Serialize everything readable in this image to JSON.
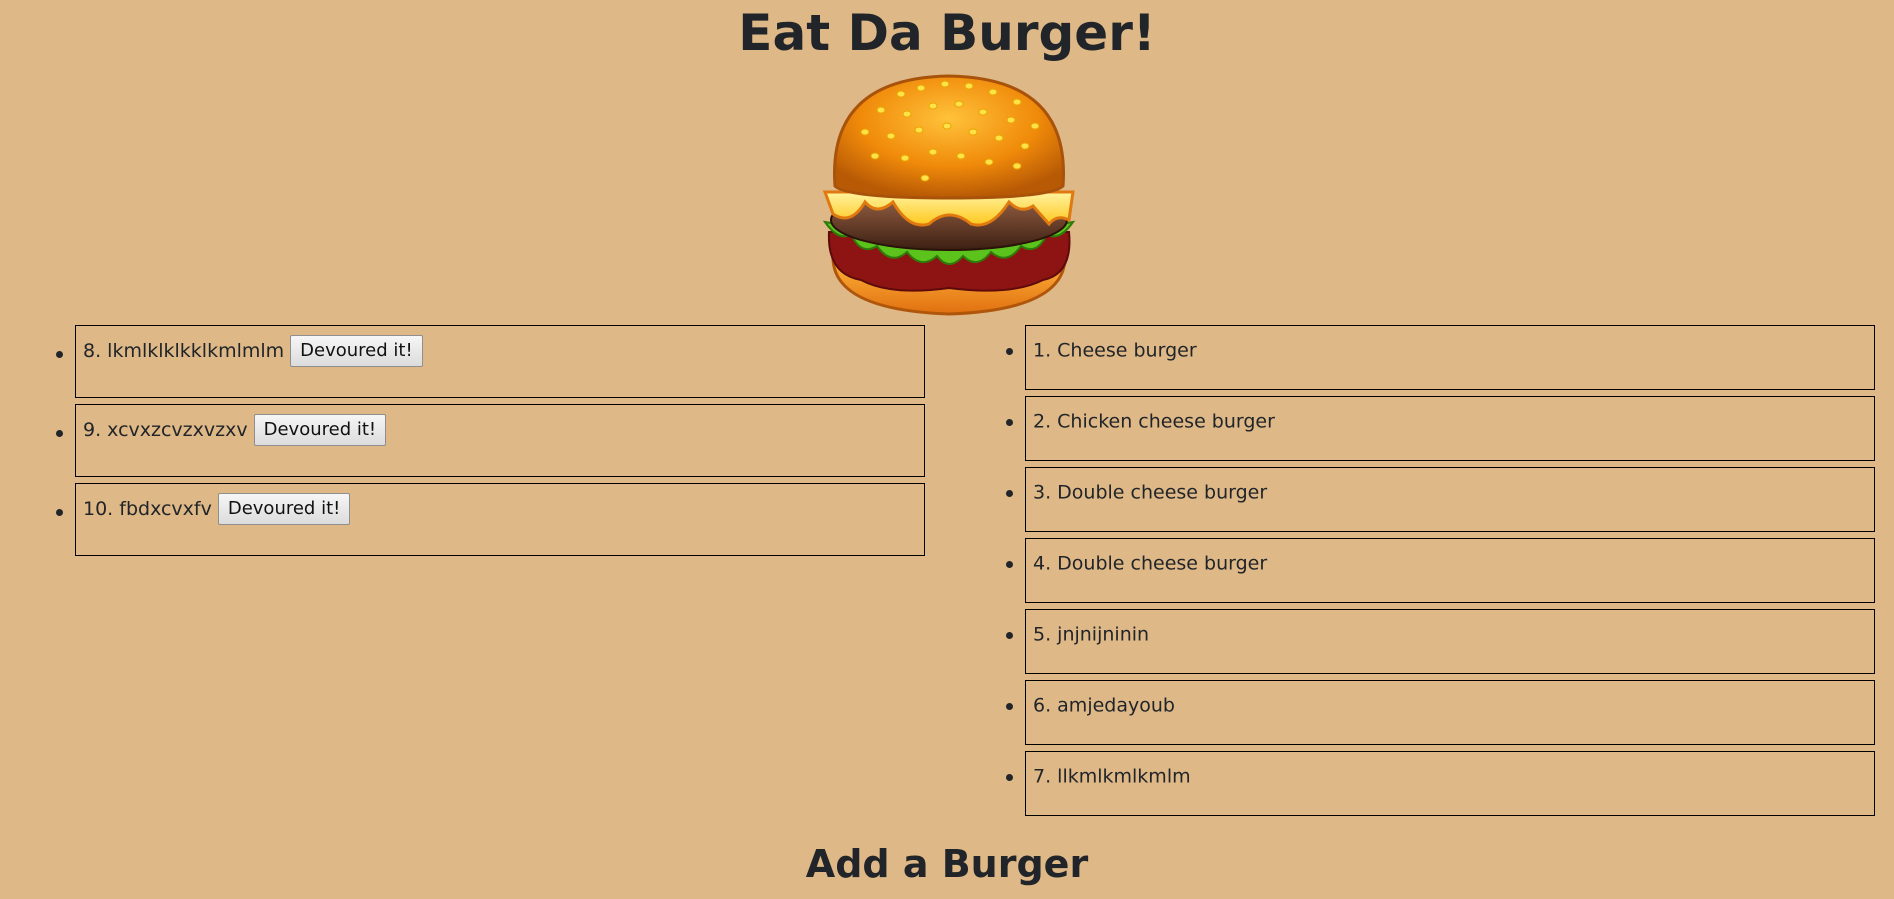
{
  "header": {
    "title": "Eat Da Burger!"
  },
  "logo": {
    "icon": "burger-icon"
  },
  "uneaten": {
    "button_label": "Devoured it!",
    "items": [
      {
        "label": "8. lkmlklklkklkmlmlm"
      },
      {
        "label": "9. xcvxzcvzxvzxv"
      },
      {
        "label": "10. fbdxcvxfv"
      }
    ]
  },
  "devoured": {
    "items": [
      {
        "label": "1. Cheese burger"
      },
      {
        "label": "2. Chicken cheese burger"
      },
      {
        "label": "3. Double cheese burger"
      },
      {
        "label": "4. Double cheese burger"
      },
      {
        "label": "5. jnjnijninin"
      },
      {
        "label": "6. amjedayoub"
      },
      {
        "label": "7. llkmlkmlkmlm"
      }
    ]
  },
  "form": {
    "title": "Add a Burger"
  },
  "colors": {
    "background": "#deb887",
    "text": "#212529",
    "border": "#000000"
  }
}
